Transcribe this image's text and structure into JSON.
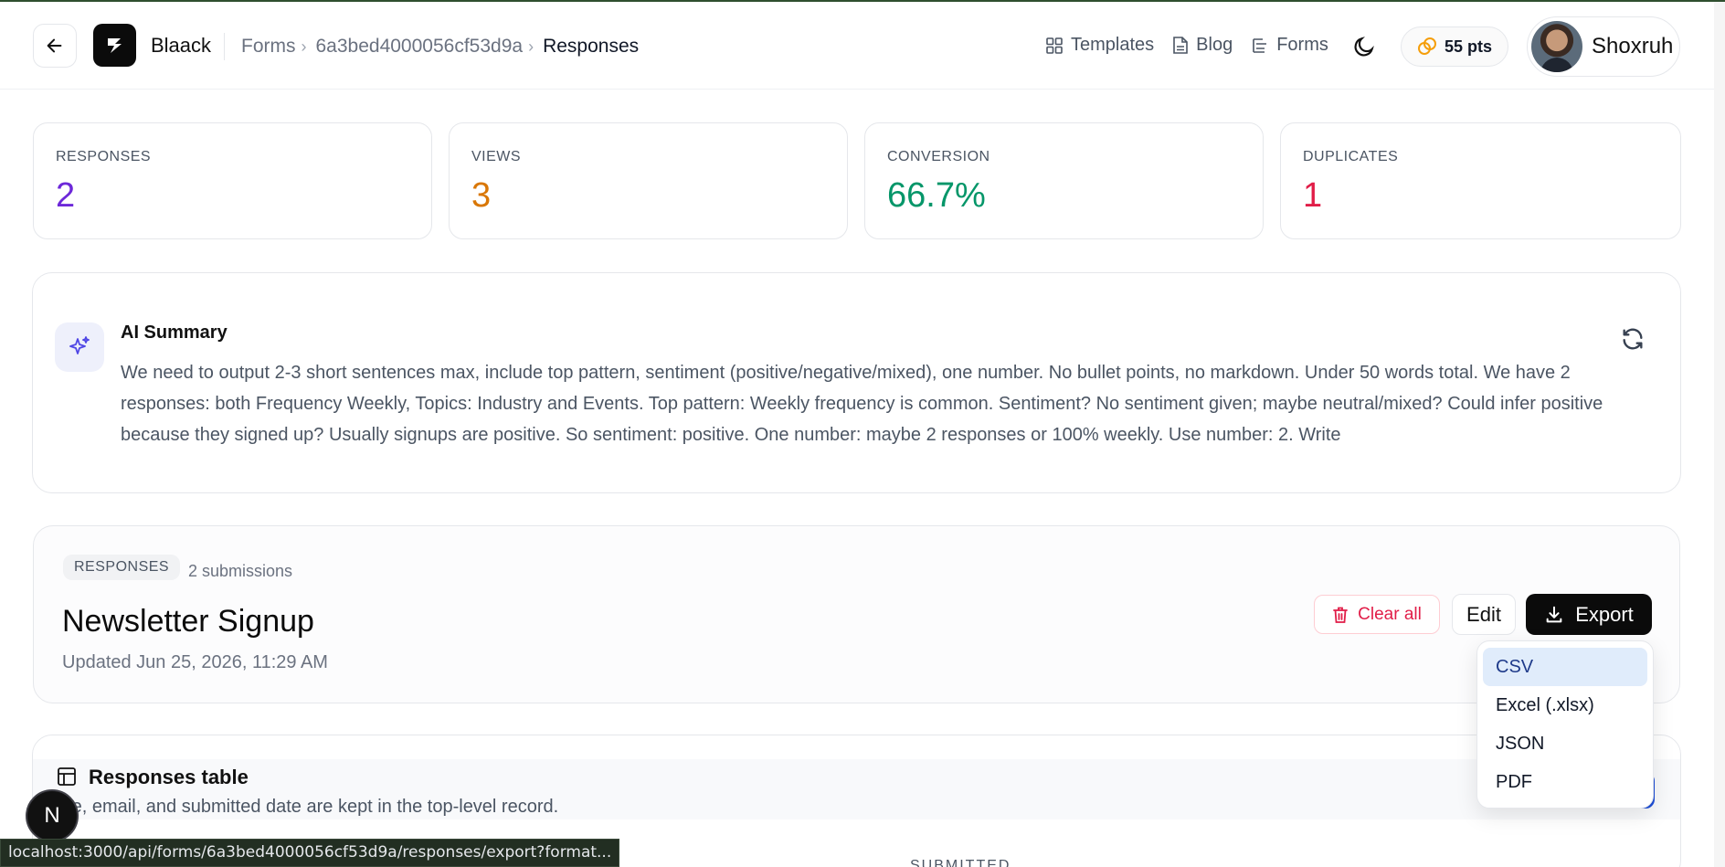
{
  "header": {
    "brand": "Blaack",
    "breadcrumb": [
      "Forms",
      "6a3bed4000056cf53d9a",
      "Responses"
    ],
    "nav": [
      {
        "label": "Templates",
        "icon": "grid-icon"
      },
      {
        "label": "Blog",
        "icon": "document-icon"
      },
      {
        "label": "Forms",
        "icon": "list-icon"
      }
    ],
    "points": "55 pts",
    "user_name": "Shoxruh"
  },
  "stats": [
    {
      "label": "RESPONSES",
      "value": "2",
      "color": "#6d28d9"
    },
    {
      "label": "VIEWS",
      "value": "3",
      "color": "#d97706"
    },
    {
      "label": "CONVERSION",
      "value": "66.7%",
      "color": "#059669"
    },
    {
      "label": "DUPLICATES",
      "value": "1",
      "color": "#e11d48"
    }
  ],
  "ai_summary": {
    "title": "AI Summary",
    "text": "We need to output 2-3 short sentences max, include top pattern, sentiment (positive/negative/mixed), one number. No bullet points, no markdown. Under 50 words total. We have 2 responses: both Frequency Weekly, Topics: Industry and Events. Top pattern: Weekly frequency is common. Sentiment? No sentiment given; maybe neutral/mixed? Could infer positive because they signed up? Usually signups are positive. So sentiment: positive. One number: maybe 2 responses or 100% weekly. Use number: 2. Write"
  },
  "form": {
    "badge": "RESPONSES",
    "submissions": "2 submissions",
    "title": "Newsletter Signup",
    "updated": "Updated Jun 25, 2026, 11:29 AM",
    "clear_label": "Clear all",
    "edit_label": "Edit",
    "export_label": "Export"
  },
  "export_menu": {
    "items": [
      "CSV",
      "Excel (.xlsx)",
      "JSON",
      "PDF"
    ],
    "highlighted": "CSV"
  },
  "table": {
    "title": "Responses table",
    "description": "me, email, and submitted date are kept in the top-level record.",
    "column_partial": "SUBMITTED"
  },
  "dev_badge": "N",
  "status_url": "localhost:3000/api/forms/6a3bed4000056cf53d9a/responses/export?format..."
}
